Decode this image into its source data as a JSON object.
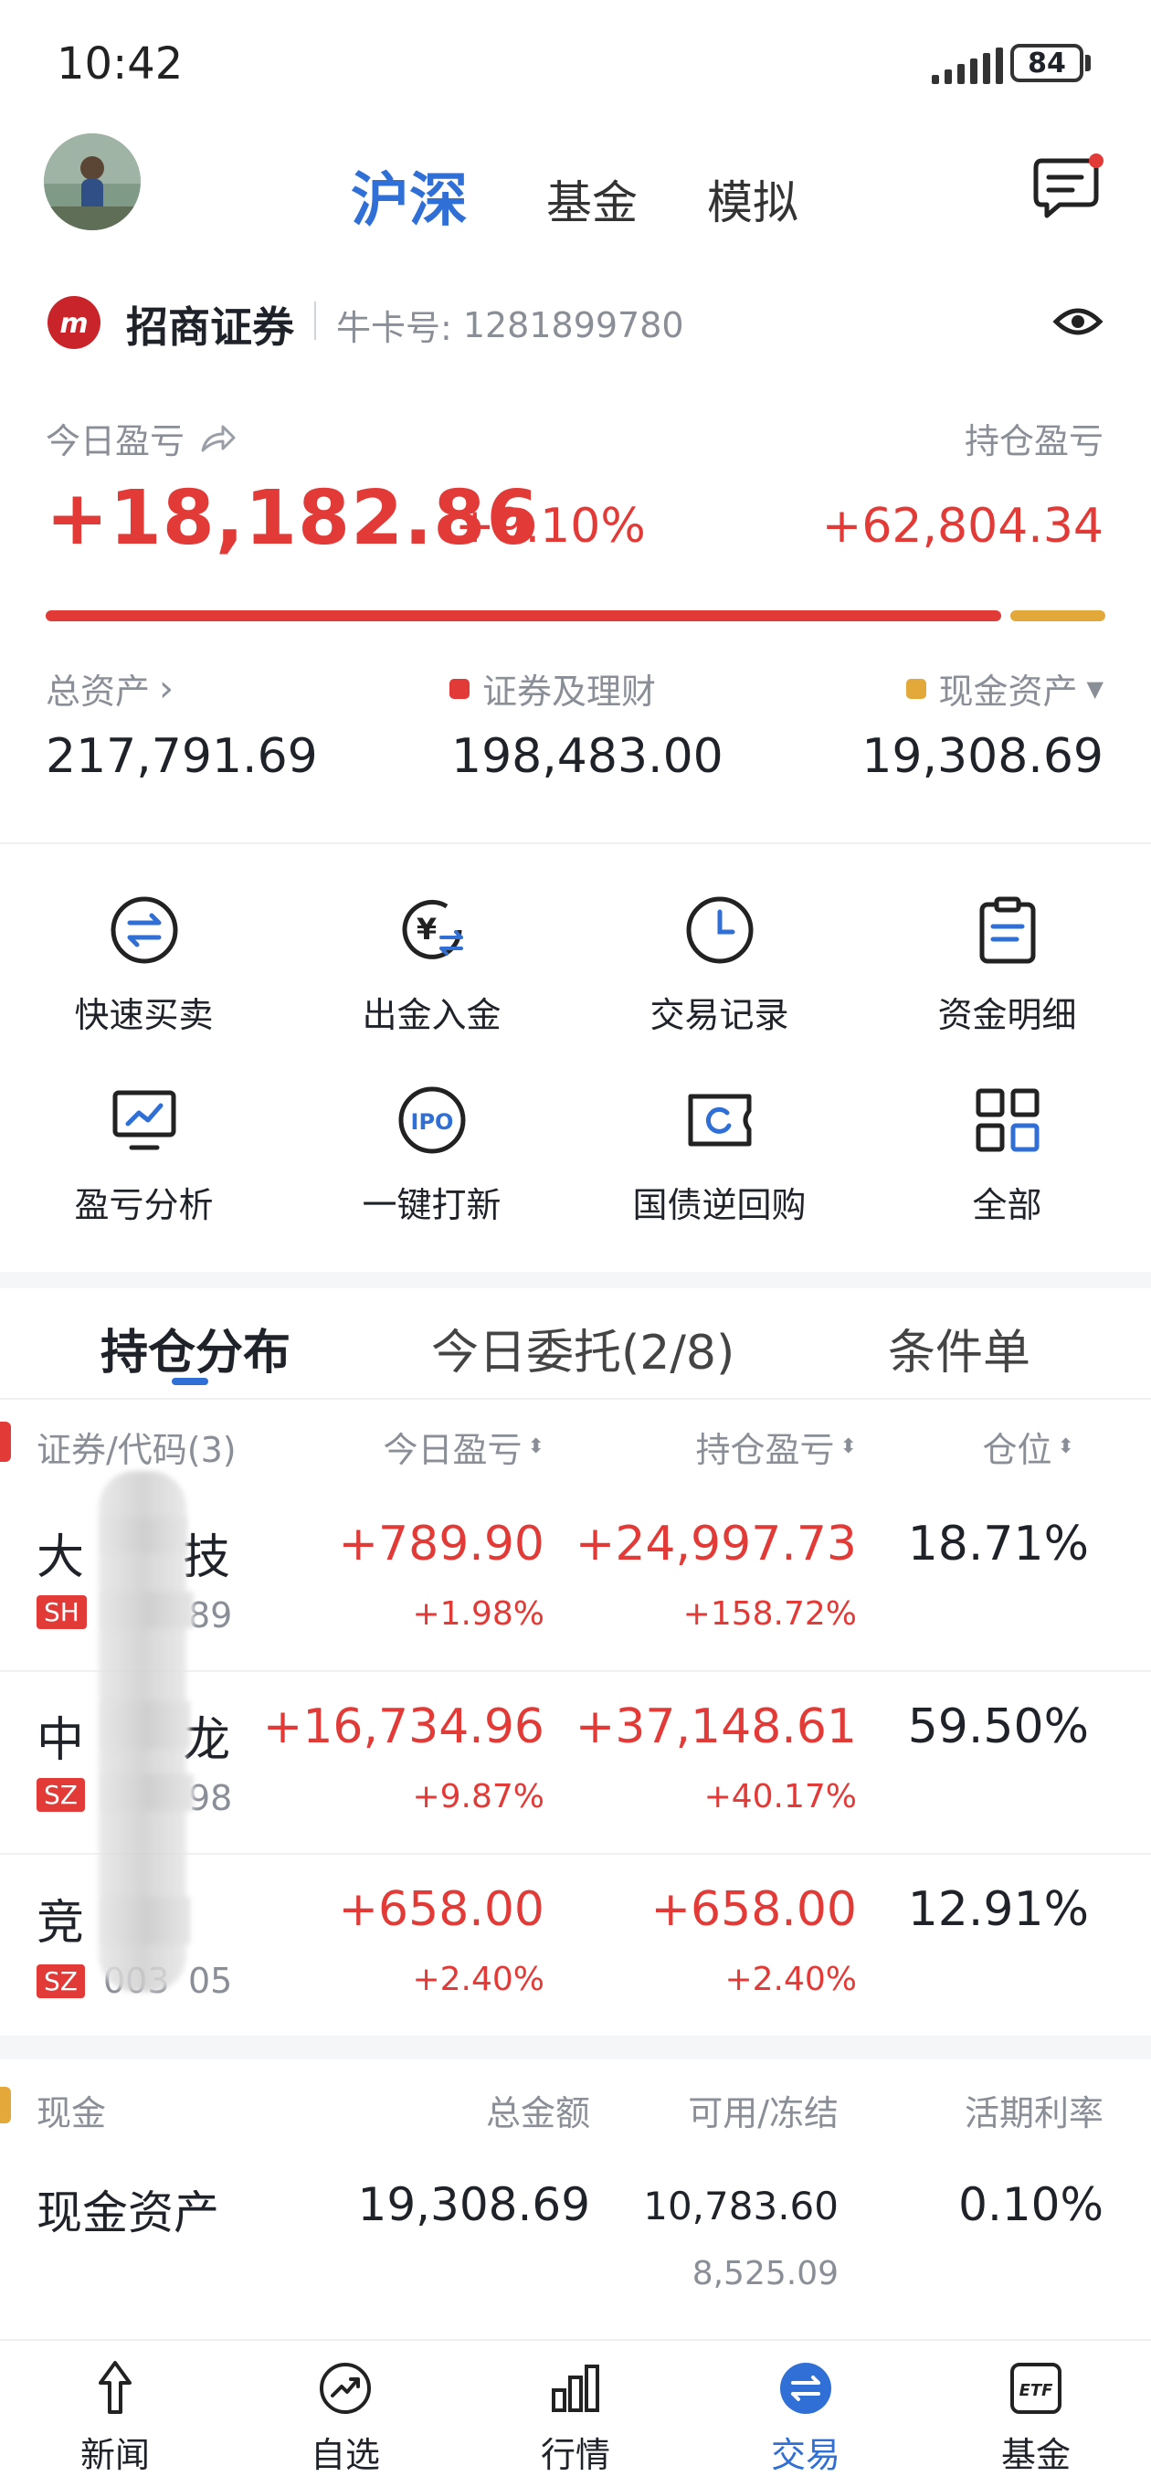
{
  "status": {
    "time": "10:42",
    "battery": "84"
  },
  "header": {
    "tabs": [
      {
        "label": "沪深",
        "active": true
      },
      {
        "label": "基金",
        "active": false
      },
      {
        "label": "模拟",
        "active": false
      }
    ]
  },
  "account": {
    "broker": "招商证券",
    "card_label": "牛卡号:",
    "card_no": "1281899780"
  },
  "profit": {
    "today_label": "今日盈亏",
    "today_value": "+18,182.86",
    "today_pct": "+9.10%",
    "hold_label": "持仓盈亏",
    "hold_value": "+62,804.34"
  },
  "assets": {
    "total_label": "总资产",
    "total_value": "217,791.69",
    "sec_label": "证券及理财",
    "sec_value": "198,483.00",
    "cash_label": "现金资产",
    "cash_value": "19,308.69"
  },
  "colors": {
    "accent": "#2f6fd6",
    "up": "#e23a36",
    "cash": "#e2a93a"
  },
  "quick_actions": [
    {
      "label": "快速买卖",
      "icon": "swap-icon"
    },
    {
      "label": "出金入金",
      "icon": "yuan-transfer-icon"
    },
    {
      "label": "交易记录",
      "icon": "clock-icon"
    },
    {
      "label": "资金明细",
      "icon": "clipboard-icon"
    },
    {
      "label": "盈亏分析",
      "icon": "monitor-chart-icon"
    },
    {
      "label": "一键打新",
      "icon": "ipo-icon"
    },
    {
      "label": "国债逆回购",
      "icon": "ticket-icon"
    },
    {
      "label": "全部",
      "icon": "grid-icon"
    }
  ],
  "holdings_tabs": [
    {
      "label": "持仓分布",
      "active": true
    },
    {
      "label": "今日委托(2/8)",
      "active": false
    },
    {
      "label": "条件单",
      "active": false
    }
  ],
  "holdings_header": {
    "name": "证券/代码(3)",
    "today": "今日盈亏",
    "hold": "持仓盈亏",
    "position": "仓位"
  },
  "holdings": [
    {
      "name_a": "大",
      "name_b": "技",
      "market": "SH",
      "code_a": "",
      "code_b": "89",
      "today": "+789.90",
      "today_pct": "+1.98%",
      "hold": "+24,997.73",
      "hold_pct": "+158.72%",
      "position": "18.71%"
    },
    {
      "name_a": "中",
      "name_b": "龙",
      "market": "SZ",
      "code_a": "",
      "code_b": "98",
      "today": "+16,734.96",
      "today_pct": "+9.87%",
      "hold": "+37,148.61",
      "hold_pct": "+40.17%",
      "position": "59.50%"
    },
    {
      "name_a": "竞",
      "name_b": "",
      "market": "SZ",
      "code_a": "003",
      "code_b": "05",
      "today": "+658.00",
      "today_pct": "+2.40%",
      "hold": "+658.00",
      "hold_pct": "+2.40%",
      "position": "12.91%"
    }
  ],
  "cash": {
    "section_label": "现金",
    "col_total": "总金额",
    "col_avail": "可用/冻结",
    "col_rate": "活期利率",
    "row_label": "现金资产",
    "total": "19,308.69",
    "available": "10,783.60",
    "frozen": "8,525.09",
    "rate": "0.10%"
  },
  "nav": [
    {
      "label": "新闻",
      "icon": "news-icon",
      "active": false
    },
    {
      "label": "自选",
      "icon": "watchlist-icon",
      "active": false
    },
    {
      "label": "行情",
      "icon": "market-icon",
      "active": false
    },
    {
      "label": "交易",
      "icon": "trade-icon",
      "active": true
    },
    {
      "label": "基金",
      "icon": "etf-icon",
      "active": false
    }
  ]
}
